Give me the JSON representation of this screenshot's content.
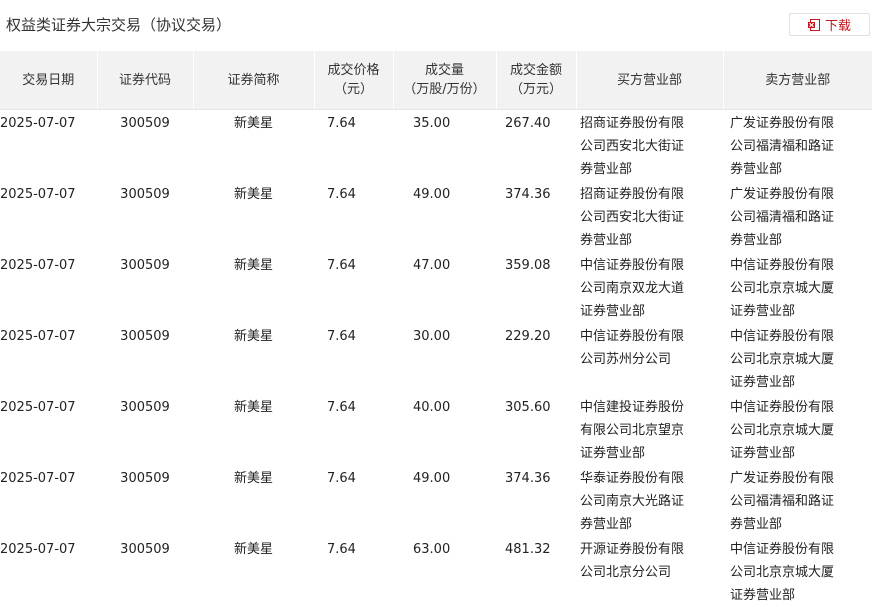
{
  "page": {
    "title": "权益类证券大宗交易（协议交易）",
    "download_label": "下载"
  },
  "colors": {
    "accent": "#c4161c",
    "header_bg": "#f2f2f2"
  },
  "table": {
    "headers": [
      [
        "交易日期"
      ],
      [
        "证券代码"
      ],
      [
        "证券简称"
      ],
      [
        "成交价格",
        "（元）"
      ],
      [
        "成交量",
        "（万股/万份）"
      ],
      [
        "成交金额",
        "（万元）"
      ],
      [
        "买方营业部"
      ],
      [
        "卖方营业部"
      ]
    ],
    "rows": [
      {
        "date": "2025-07-07",
        "code": "300509",
        "name": "新美星",
        "price": "7.64",
        "volume": "35.00",
        "amount": "267.40",
        "buyer": "招商证券股份有限公司西安北大街证券营业部",
        "seller": "广发证券股份有限公司福清福和路证券营业部"
      },
      {
        "date": "2025-07-07",
        "code": "300509",
        "name": "新美星",
        "price": "7.64",
        "volume": "49.00",
        "amount": "374.36",
        "buyer": "招商证券股份有限公司西安北大街证券营业部",
        "seller": "广发证券股份有限公司福清福和路证券营业部"
      },
      {
        "date": "2025-07-07",
        "code": "300509",
        "name": "新美星",
        "price": "7.64",
        "volume": "47.00",
        "amount": "359.08",
        "buyer": "中信证券股份有限公司南京双龙大道证券营业部",
        "seller": "中信证券股份有限公司北京京城大厦证券营业部"
      },
      {
        "date": "2025-07-07",
        "code": "300509",
        "name": "新美星",
        "price": "7.64",
        "volume": "30.00",
        "amount": "229.20",
        "buyer": "中信证券股份有限公司苏州分公司",
        "seller": "中信证券股份有限公司北京京城大厦证券营业部"
      },
      {
        "date": "2025-07-07",
        "code": "300509",
        "name": "新美星",
        "price": "7.64",
        "volume": "40.00",
        "amount": "305.60",
        "buyer": "中信建投证券股份有限公司北京望京证券营业部",
        "seller": "中信证券股份有限公司北京京城大厦证券营业部"
      },
      {
        "date": "2025-07-07",
        "code": "300509",
        "name": "新美星",
        "price": "7.64",
        "volume": "49.00",
        "amount": "374.36",
        "buyer": "华泰证券股份有限公司南京大光路证券营业部",
        "seller": "广发证券股份有限公司福清福和路证券营业部"
      },
      {
        "date": "2025-07-07",
        "code": "300509",
        "name": "新美星",
        "price": "7.64",
        "volume": "63.00",
        "amount": "481.32",
        "buyer": "开源证券股份有限公司北京分公司",
        "seller": "中信证券股份有限公司北京京城大厦证券营业部"
      }
    ]
  }
}
